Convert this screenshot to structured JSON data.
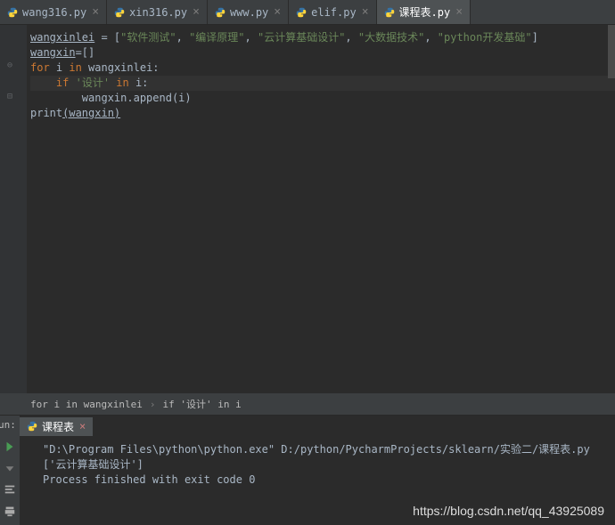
{
  "tabs": [
    {
      "name": "wang316.py",
      "active": false
    },
    {
      "name": "xin316.py",
      "active": false
    },
    {
      "name": "www.py",
      "active": false
    },
    {
      "name": "elif.py",
      "active": false
    },
    {
      "name": "课程表.py",
      "active": true
    }
  ],
  "code": {
    "l1_var": "wangxinlei",
    "l1_eq": " = [",
    "l1_s1": "\"软件测试\"",
    "l1_c1": ", ",
    "l1_s2": "\"编译原理\"",
    "l1_c2": ", ",
    "l1_s3": "\"云计算基础设计\"",
    "l1_c3": ", ",
    "l1_s4": "\"大数据技术\"",
    "l1_c4": ", ",
    "l1_s5": "\"python开发基础\"",
    "l1_end": "]",
    "l2_var": "wangxin",
    "l2_rest": "=[]",
    "l3_kw1": "for",
    "l3_mid": " i ",
    "l3_kw2": "in",
    "l3_rest": " wangxinlei:",
    "l4_kw": "if",
    "l4_sp": " ",
    "l4_str": "'设计'",
    "l4_sp2": " ",
    "l4_kw2": "in",
    "l4_rest": " i:",
    "l5": "wangxin.append(i)",
    "l6_fn": "print",
    "l6_arg": "(wangxin)"
  },
  "breadcrumb": {
    "c1": "for i in wangxinlei",
    "c2": "if '设计' in i"
  },
  "run": {
    "label": "un:",
    "tab": "课程表",
    "line1": "\"D:\\Program Files\\python\\python.exe\" D:/python/PycharmProjects/sklearn/实验二/课程表.py",
    "line2": "['云计算基础设计']",
    "line3": "",
    "line4": "Process finished with exit code 0"
  },
  "watermark": "https://blog.csdn.net/qq_43925089"
}
